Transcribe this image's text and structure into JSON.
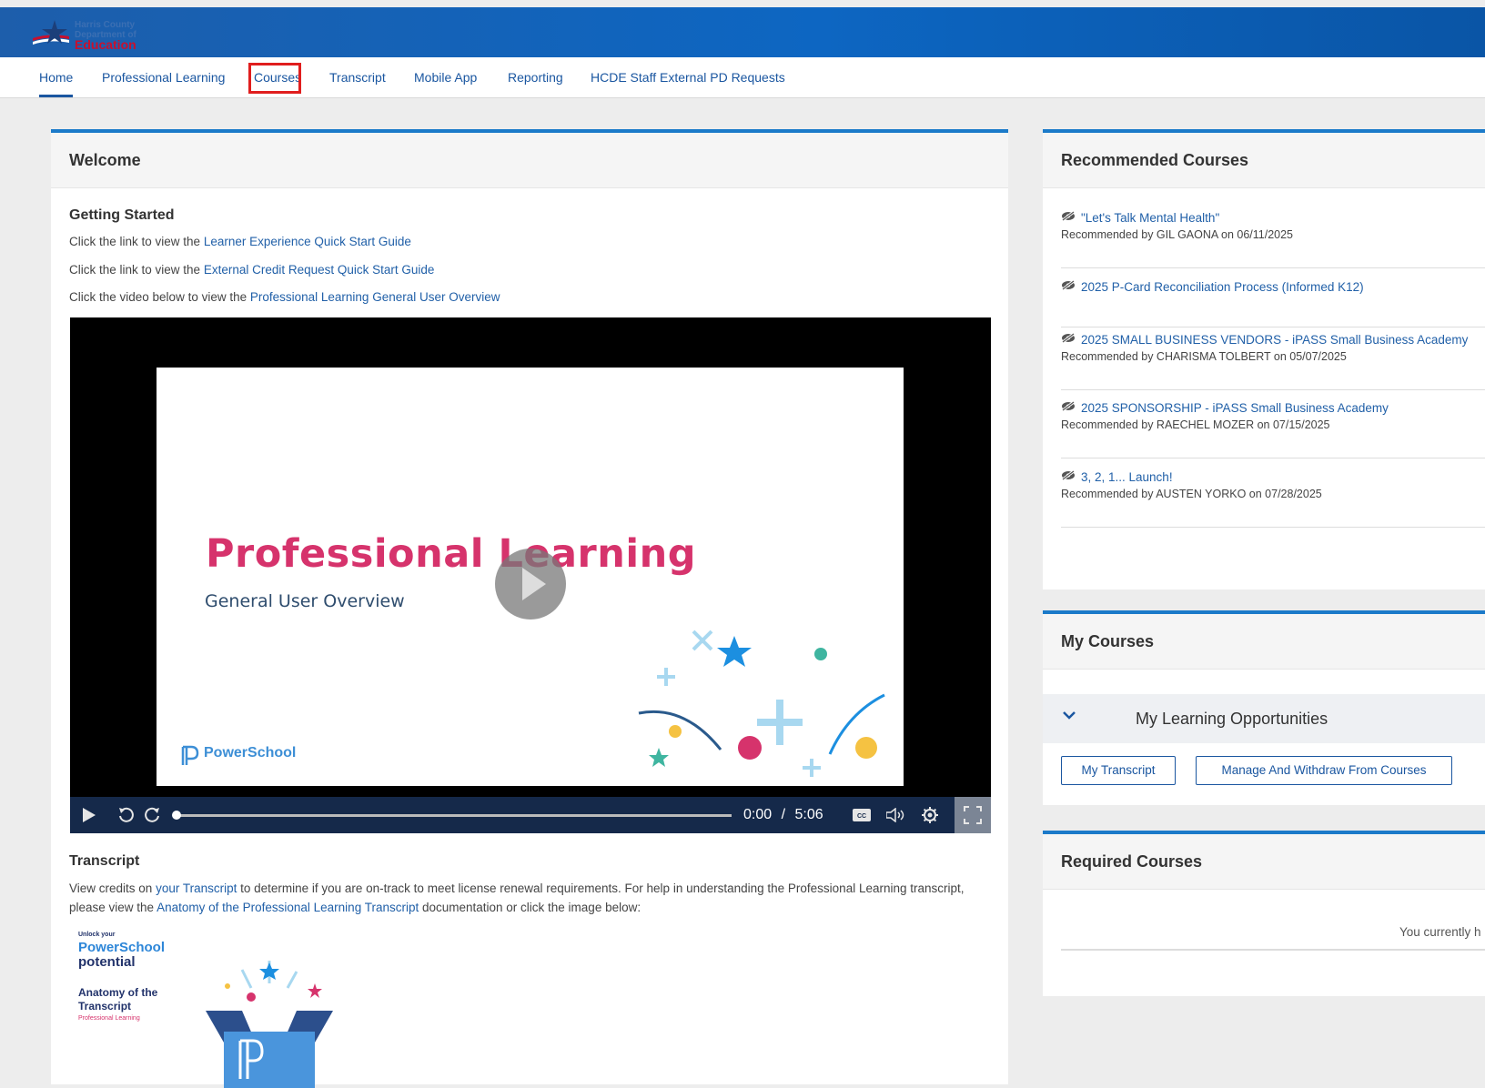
{
  "header": {
    "logo": {
      "line1": "Harris County",
      "line2": "Department of",
      "line3": "Education"
    }
  },
  "nav": {
    "items": [
      "Home",
      "Professional Learning",
      "Courses",
      "Transcript",
      "Mobile App",
      "Reporting",
      "HCDE Staff External PD Requests"
    ],
    "active": "Home"
  },
  "welcome": {
    "title": "Welcome",
    "getting_started": "Getting Started",
    "lines": [
      {
        "prefix": "Click the link to view the ",
        "link": "Learner Experience Quick Start Guide"
      },
      {
        "prefix": "Click the link to view the ",
        "link": "External Credit Request Quick Start Guide"
      },
      {
        "prefix": "Click the video below to view the ",
        "link": "Professional Learning General User Overview"
      }
    ],
    "video": {
      "slide_title": "Professional Learning",
      "slide_subtitle": "General User Overview",
      "slide_logo": "PowerSchool",
      "current_time": "0:00",
      "separator": "/",
      "duration": "5:06",
      "progress": 0
    },
    "transcript": {
      "title": "Transcript",
      "t1": "View credits on ",
      "link1": "your Transcript",
      "t2": " to determine if you are on-track to meet license renewal requirements. For help in understanding the Professional Learning transcript, please view the ",
      "link2": "Anatomy of the Professional Learning Transcript",
      "t3": " documentation or click the image below:"
    },
    "anatomy_image": {
      "small": "Unlock your",
      "brand": "PowerSchool",
      "potential": "potential",
      "title": "Anatomy of the Transcript",
      "sub": "Professional Learning"
    }
  },
  "recommended": {
    "title": "Recommended Courses",
    "items": [
      {
        "title": "\"Let's Talk Mental Health\"",
        "by": "Recommended by GIL GAONA on 06/11/2025"
      },
      {
        "title": "2025 P-Card Reconciliation Process (Informed K12)",
        "by": ""
      },
      {
        "title": "2025 SMALL BUSINESS VENDORS - iPASS Small Business Academy",
        "by": "Recommended by CHARISMA TOLBERT on 05/07/2025"
      },
      {
        "title": "2025 SPONSORSHIP - iPASS Small Business Academy",
        "by": "Recommended by RAECHEL MOZER on 07/15/2025"
      },
      {
        "title": "3, 2, 1... Launch!",
        "by": "Recommended by AUSTEN YORKO on 07/28/2025"
      }
    ]
  },
  "my_courses": {
    "title": "My Courses",
    "section": "My Learning Opportunities",
    "buttons": {
      "transcript": "My Transcript",
      "manage": "Manage And Withdraw From Courses"
    }
  },
  "required": {
    "title": "Required Courses",
    "text": "You currently h"
  },
  "colors": {
    "accent": "#1b7ac9",
    "link": "#2160a8",
    "highlight": "#e01e1e",
    "slide_title": "#d6336c"
  }
}
